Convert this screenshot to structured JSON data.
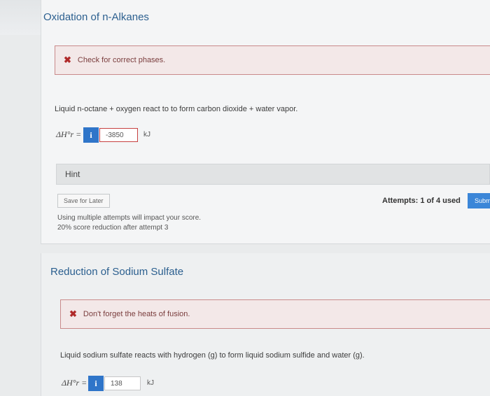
{
  "problem1": {
    "title": "Oxidation of n-Alkanes",
    "alert_text": "Check for correct phases.",
    "prompt": "Liquid n-octane + oxygen react to to form carbon dioxide + water vapor.",
    "dh_label": "ΔH°r =",
    "answer_value": "-3850",
    "unit": "kJ",
    "hint_label": "Hint",
    "save_label": "Save for Later",
    "attempts_text": "Attempts: 1 of 4 used",
    "submit_label": "Subm",
    "note_line1": "Using multiple attempts will impact your score.",
    "note_line2": "20% score reduction after attempt 3"
  },
  "problem2": {
    "title": "Reduction of Sodium Sulfate",
    "alert_text": "Don't forget the heats of fusion.",
    "prompt": "Liquid sodium sulfate reacts with hydrogen (g) to form liquid sodium sulfide and water (g).",
    "dh_label": "ΔH°r =",
    "answer_value": "138",
    "unit": "kJ"
  },
  "icons": {
    "error": "✖",
    "info": "i"
  },
  "colors": {
    "title_blue": "#2b5f8f",
    "error_red": "#c74141",
    "info_blue": "#2f75c9",
    "submit_blue": "#3b86d8"
  }
}
